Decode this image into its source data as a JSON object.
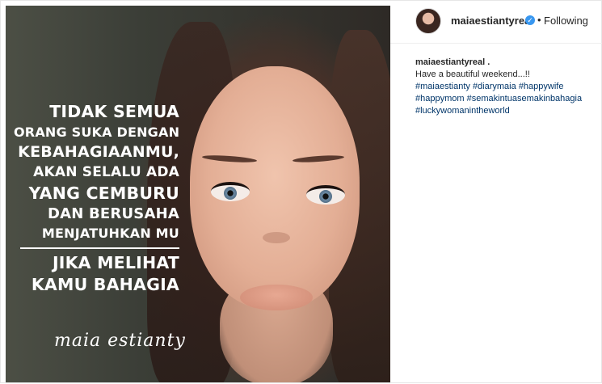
{
  "post": {
    "quote_lines": [
      "TIDAK SEMUA",
      "ORANG SUKA DENGAN",
      "KEBAHAGIAANMU,",
      "AKAN SELALU ADA",
      "YANG CEMBURU",
      "DAN BERUSAHA",
      "MENJATUHKAN MU",
      "JIKA MELIHAT",
      "KAMU BAHAGIA"
    ],
    "signature": "maia estianty"
  },
  "header": {
    "username": "maiaestiantyreal",
    "verified_icon": "verified-badge-icon",
    "separator": "•",
    "follow_status": "Following"
  },
  "caption": {
    "username": "maiaestiantyreal .",
    "text": "Have a beautiful weekend...!!",
    "hashtags": [
      "#maiaestianty",
      "#diarymaia",
      "#happywife",
      "#happymom",
      "#semakintuasemakinbahagia",
      "#luckywomanintheworld"
    ]
  },
  "colors": {
    "link": "#003569",
    "verified": "#3897f0",
    "text": "#262626"
  }
}
